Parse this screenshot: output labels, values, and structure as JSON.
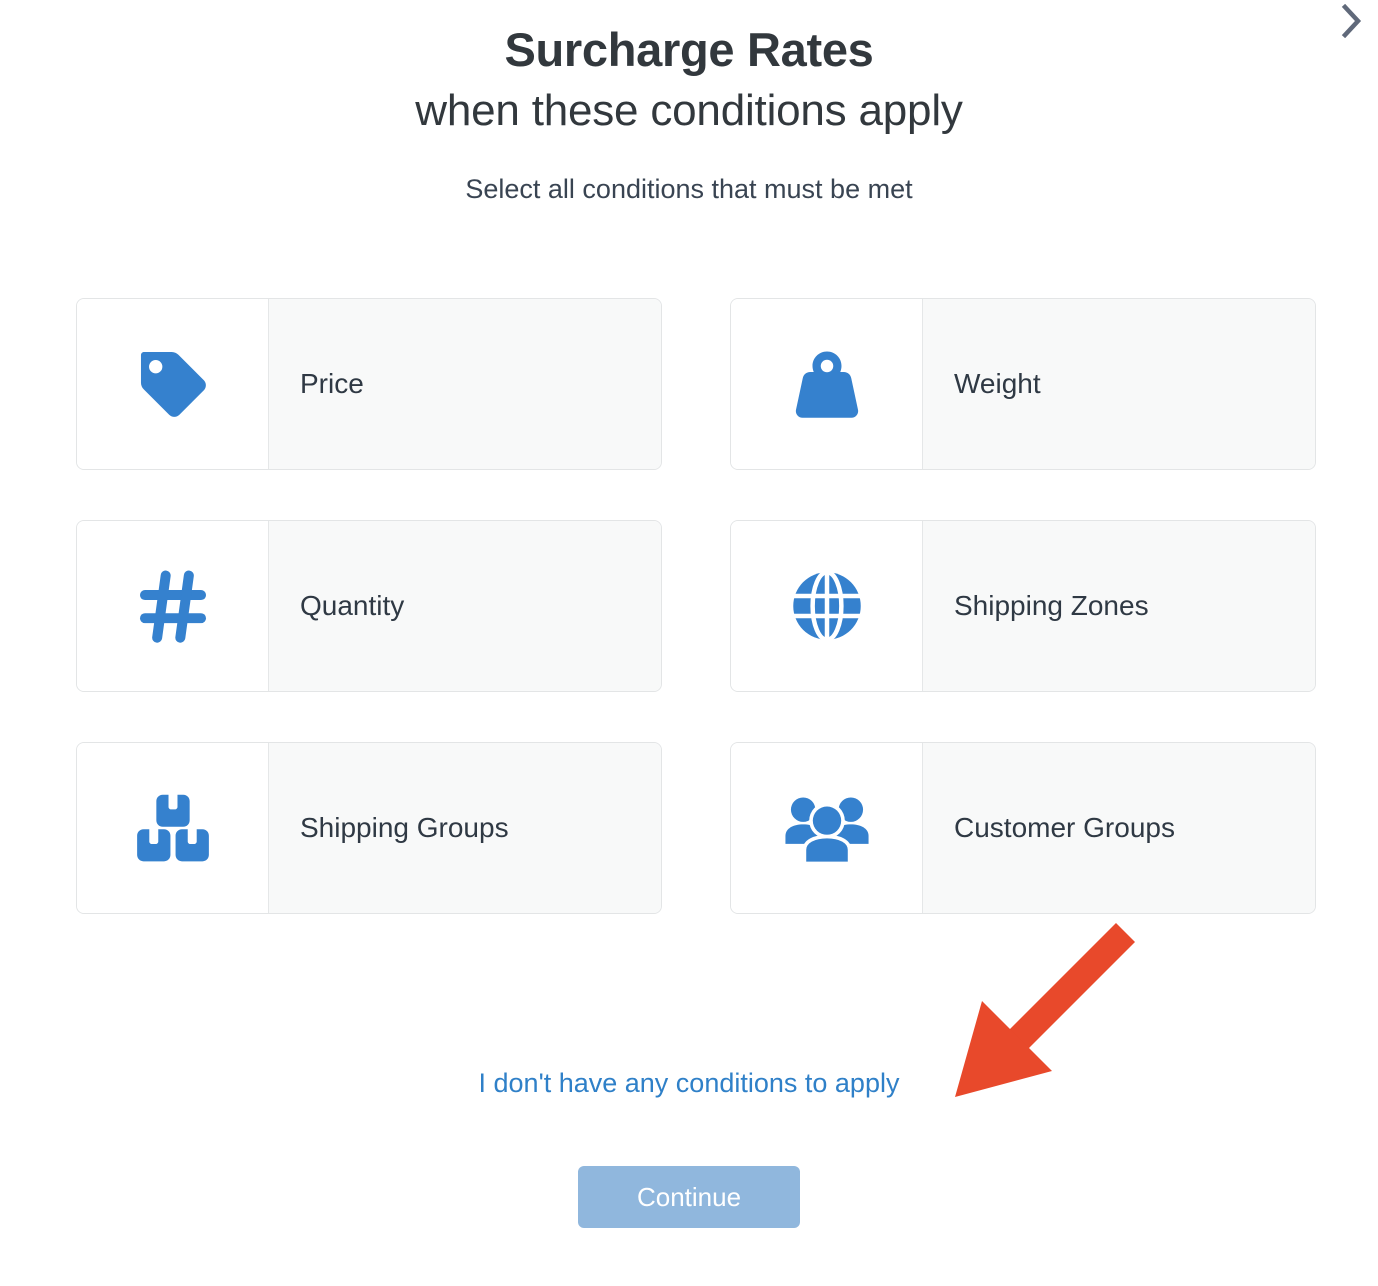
{
  "header": {
    "title": "Surcharge Rates",
    "title_line2": "when these conditions apply",
    "subtitle": "Select all conditions that must be met",
    "next_icon": "chevron-right-icon"
  },
  "options": [
    {
      "label": "Price",
      "icon": "price-tag-icon"
    },
    {
      "label": "Weight",
      "icon": "weight-icon"
    },
    {
      "label": "Quantity",
      "icon": "hashtag-icon"
    },
    {
      "label": "Shipping Zones",
      "icon": "globe-icon"
    },
    {
      "label": "Shipping Groups",
      "icon": "boxes-icon"
    },
    {
      "label": "Customer Groups",
      "icon": "people-group-icon"
    }
  ],
  "skip_link": {
    "label": "I don't have any conditions to apply"
  },
  "footer": {
    "continue_label": "Continue"
  },
  "annotation": {
    "arrow_icon": "arrow-down-left-icon",
    "color": "#e8492b"
  },
  "colors": {
    "icon_blue": "#3581ce",
    "link_blue": "#2f80c8",
    "button_blue": "#90b7dd",
    "text_dark": "#32383d",
    "card_bg": "#f8f9f9",
    "card_border": "#e3e5e6",
    "annotation_red": "#e8492b"
  }
}
